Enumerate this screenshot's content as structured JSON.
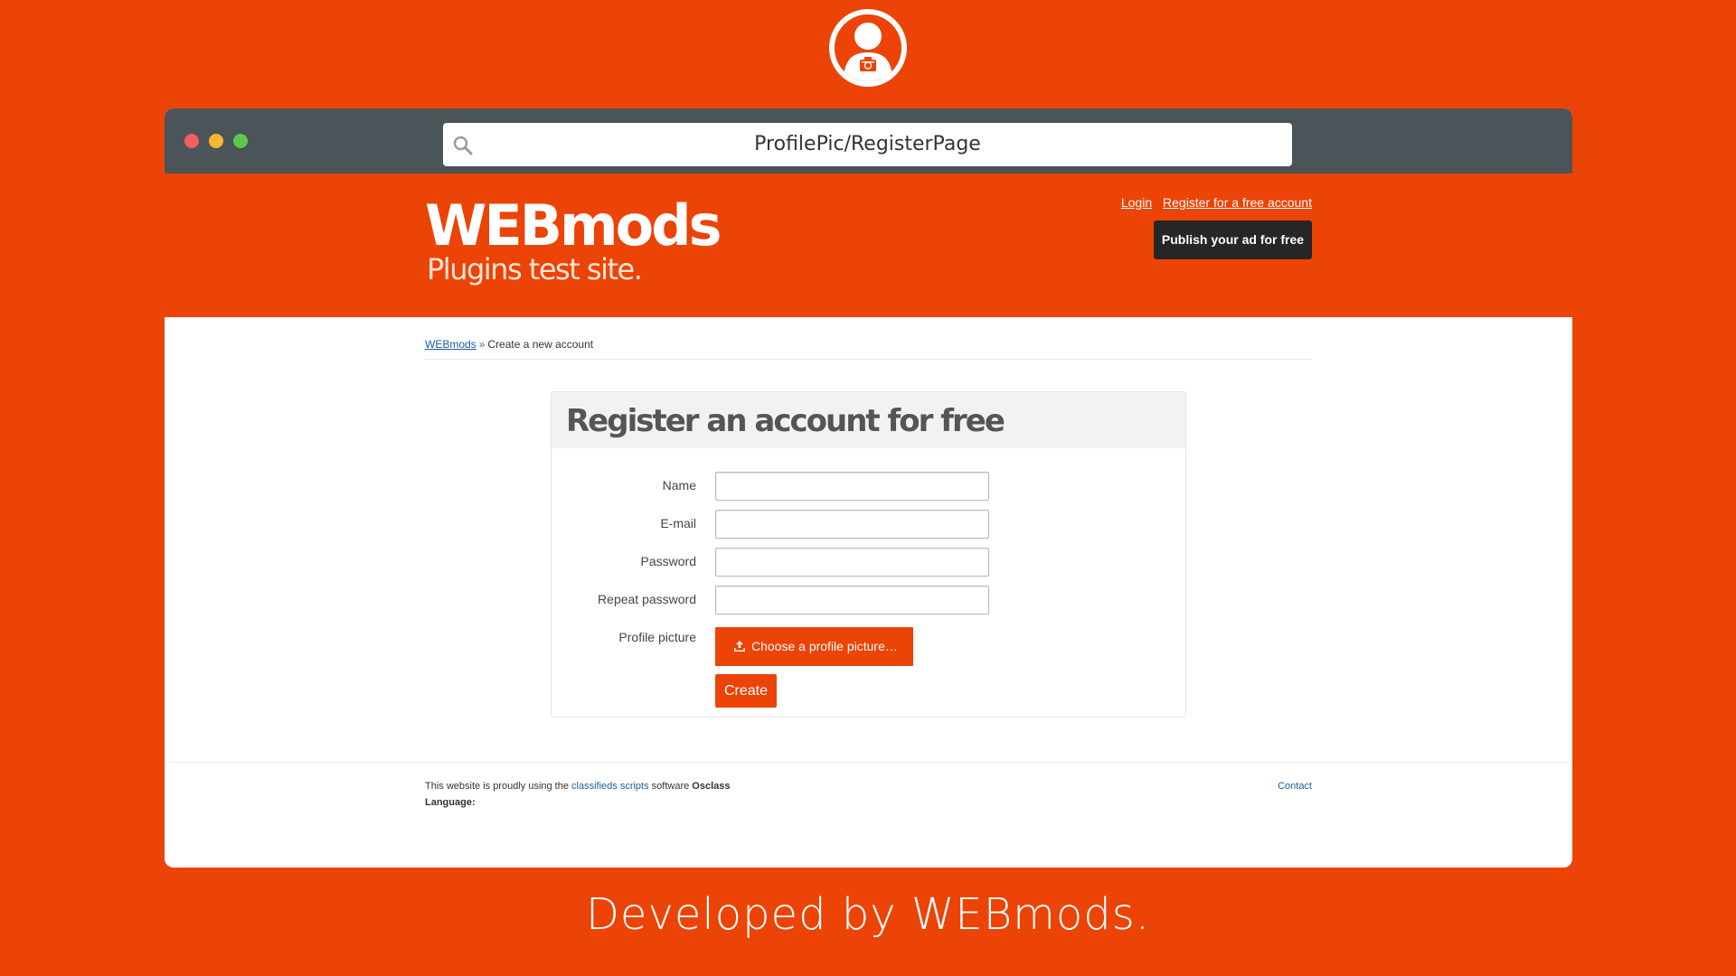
{
  "browser": {
    "url": "ProfilePic/RegisterPage",
    "colors": {
      "titlebar": "#4a5459",
      "close": "#f25f5c",
      "minimize": "#f7b733",
      "maximize": "#5cc94d"
    }
  },
  "header": {
    "logo_title": "WEBmods",
    "logo_subtitle": "Plugins test site.",
    "login_link": "Login",
    "register_link": "Register for a free account",
    "publish_button": "Publish your ad for free"
  },
  "breadcrumb": {
    "home": "WEBmods",
    "separator": "»",
    "current": "Create a new account"
  },
  "form": {
    "title": "Register an account for free",
    "fields": [
      {
        "label": "Name",
        "value": ""
      },
      {
        "label": "E-mail",
        "value": ""
      },
      {
        "label": "Password",
        "value": ""
      },
      {
        "label": "Repeat password",
        "value": ""
      }
    ],
    "profile_label": "Profile picture",
    "upload_button": "Choose a profile picture…",
    "create_button": "Create"
  },
  "footer": {
    "text_before": "This website is proudly using the ",
    "link_text": "classifieds scripts",
    "text_after": " software ",
    "brand": "Osclass",
    "language_label": "Language:",
    "contact_link": "Contact"
  },
  "caption": "Developed by WEBmods.",
  "theme": {
    "accent": "#ec4306",
    "dark_button": "#262626",
    "link": "#1b5e9e"
  },
  "icons": [
    "user-avatar-icon",
    "camera-icon",
    "search-icon",
    "upload-icon"
  ]
}
